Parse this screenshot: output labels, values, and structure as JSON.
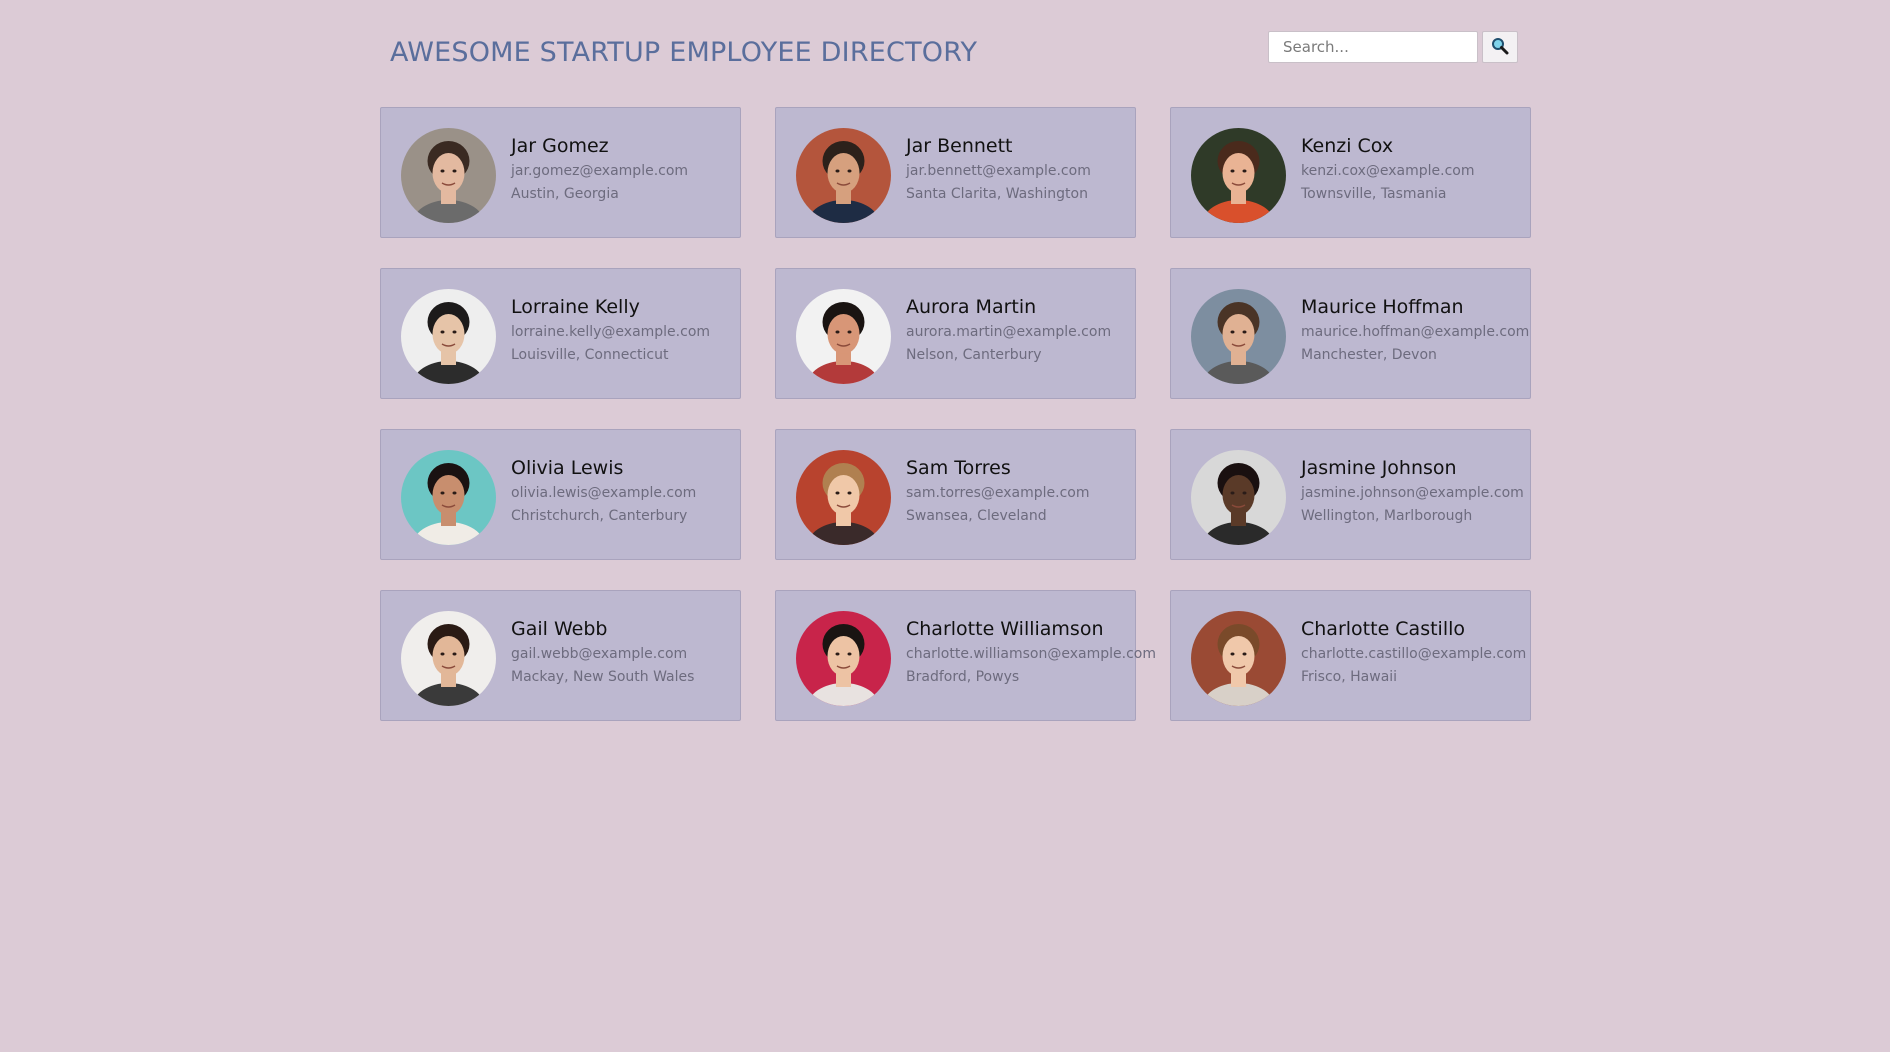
{
  "header": {
    "title": "AWESOME STARTUP EMPLOYEE DIRECTORY"
  },
  "search": {
    "placeholder": "Search...",
    "value": "",
    "button_icon": "search-icon"
  },
  "colors": {
    "background": "#dccbd6",
    "card": "#bdb8d0",
    "title": "#5a6e9c"
  },
  "employees": [
    {
      "name": "Jar Gomez",
      "email": "jar.gomez@example.com",
      "location": "Austin, Georgia",
      "avatar": {
        "bg": "#9a9188",
        "skin": "#e3b9a0",
        "hair": "#3a2a22",
        "shirt": "#6b6b6b"
      }
    },
    {
      "name": "Jar Bennett",
      "email": "jar.bennett@example.com",
      "location": "Santa Clarita, Washington",
      "avatar": {
        "bg": "#b4553c",
        "skin": "#d6a07e",
        "hair": "#2c211b",
        "shirt": "#1e2c44"
      }
    },
    {
      "name": "Kenzi Cox",
      "email": "kenzi.cox@example.com",
      "location": "Townsville, Tasmania",
      "avatar": {
        "bg": "#2f3a28",
        "skin": "#e9b394",
        "hair": "#4a2a1c",
        "shirt": "#d9502c"
      }
    },
    {
      "name": "Lorraine Kelly",
      "email": "lorraine.kelly@example.com",
      "location": "Louisville, Connecticut",
      "avatar": {
        "bg": "#eeeeee",
        "skin": "#e6c4a8",
        "hair": "#1c1a1a",
        "shirt": "#2c2c2c"
      }
    },
    {
      "name": "Aurora Martin",
      "email": "aurora.martin@example.com",
      "location": "Nelson, Canterbury",
      "avatar": {
        "bg": "#f2f2f2",
        "skin": "#d89677",
        "hair": "#1a1412",
        "shirt": "#b33a3a"
      }
    },
    {
      "name": "Maurice Hoffman",
      "email": "maurice.hoffman@example.com",
      "location": "Manchester, Devon",
      "avatar": {
        "bg": "#7d8ea0",
        "skin": "#e0b193",
        "hair": "#4a3426",
        "shirt": "#5a5a5a"
      }
    },
    {
      "name": "Olivia Lewis",
      "email": "olivia.lewis@example.com",
      "location": "Christchurch, Canterbury",
      "avatar": {
        "bg": "#6cc6c4",
        "skin": "#c88e6e",
        "hair": "#1a1212",
        "shirt": "#f0ece6"
      }
    },
    {
      "name": "Sam Torres",
      "email": "sam.torres@example.com",
      "location": "Swansea, Cleveland",
      "avatar": {
        "bg": "#b8432e",
        "skin": "#f0c8a8",
        "hair": "#b08050",
        "shirt": "#3a2a2a"
      }
    },
    {
      "name": "Jasmine Johnson",
      "email": "jasmine.johnson@example.com",
      "location": "Wellington, Marlborough",
      "avatar": {
        "bg": "#d8d8d8",
        "skin": "#5a3a28",
        "hair": "#1a1010",
        "shirt": "#2a2a2a"
      }
    },
    {
      "name": "Gail Webb",
      "email": "gail.webb@example.com",
      "location": "Mackay, New South Wales",
      "avatar": {
        "bg": "#f0eeec",
        "skin": "#e2b798",
        "hair": "#2a1a14",
        "shirt": "#3a3a3a"
      }
    },
    {
      "name": "Charlotte Williamson",
      "email": "charlotte.williamson@example.com",
      "location": "Bradford, Powys",
      "avatar": {
        "bg": "#c8244a",
        "skin": "#edc3a4",
        "hair": "#1a1412",
        "shirt": "#e8e2e0"
      }
    },
    {
      "name": "Charlotte Castillo",
      "email": "charlotte.castillo@example.com",
      "location": "Frisco, Hawaii",
      "avatar": {
        "bg": "#9a4a34",
        "skin": "#f0c8aa",
        "hair": "#7a4a2a",
        "shirt": "#d8d0c8"
      }
    }
  ]
}
